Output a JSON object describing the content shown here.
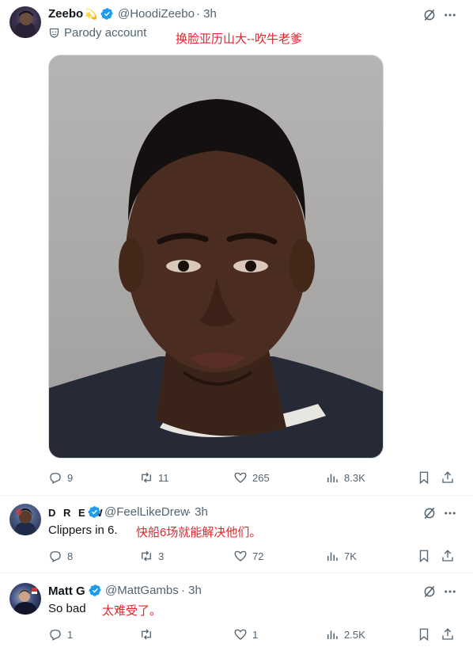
{
  "tweets": [
    {
      "name": "Zeebo",
      "name_emoji": "💫",
      "handle": "@HoodiZeebo",
      "time": "· 3h",
      "label_icon": "parody-mask-icon",
      "label": "Parody account",
      "note_cn": "换脸亚历山大--吹牛老爹",
      "media": "mugshot-photo",
      "replies": "9",
      "retweets": "11",
      "likes": "265",
      "views": "8.3K"
    },
    {
      "name": "D R E W",
      "handle": "@FeelLikeDrew",
      "time": "· 3h",
      "text": "Clippers in 6.",
      "note_cn": "快船6场就能解决他们。",
      "replies": "8",
      "retweets": "3",
      "likes": "72",
      "views": "7K"
    },
    {
      "name": "Matt G",
      "handle": "@MattGambs",
      "time": "· 3h",
      "text": "So bad",
      "note_cn": "太难受了。",
      "replies": "1",
      "retweets": "",
      "likes": "1",
      "views": "2.5K"
    }
  ],
  "colors": {
    "verified": "#1d9bf0",
    "note": "#e0262b",
    "muted": "#536471"
  }
}
